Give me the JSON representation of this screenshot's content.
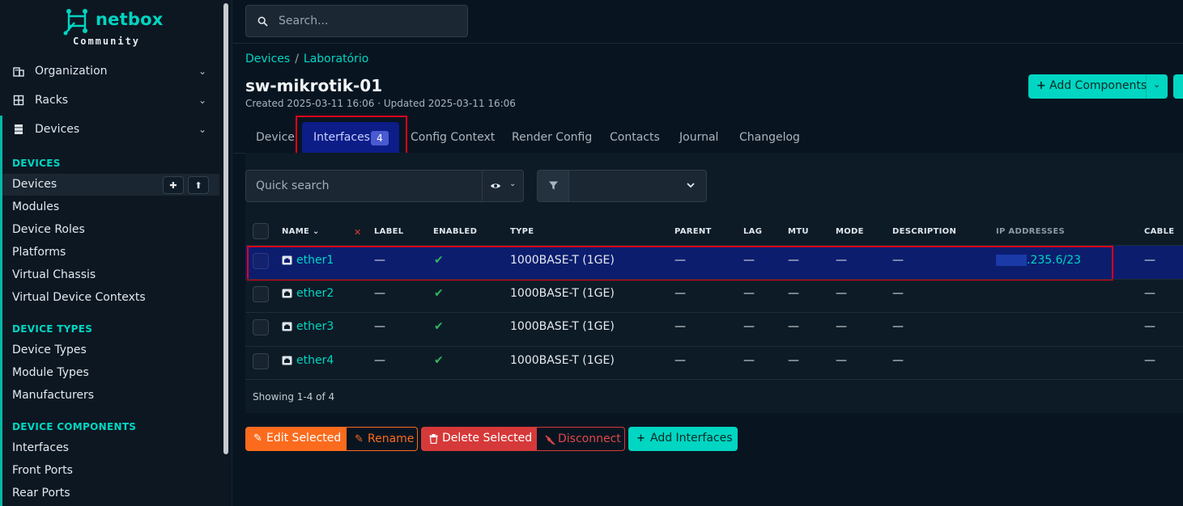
{
  "brand": {
    "name": "netbox",
    "edition": "Community",
    "accent": "#00d6c2"
  },
  "sidebar": {
    "top_menu": [
      {
        "label": "Organization",
        "icon": "organization-icon"
      },
      {
        "label": "Racks",
        "icon": "rack-icon"
      },
      {
        "label": "Devices",
        "icon": "server-icon"
      }
    ],
    "sections": [
      {
        "heading": "DEVICES",
        "items": [
          "Devices",
          "Modules",
          "Device Roles",
          "Platforms",
          "Virtual Chassis",
          "Virtual Device Contexts"
        ]
      },
      {
        "heading": "DEVICE TYPES",
        "items": [
          "Device Types",
          "Module Types",
          "Manufacturers"
        ]
      },
      {
        "heading": "DEVICE COMPONENTS",
        "items": [
          "Interfaces",
          "Front Ports",
          "Rear Ports"
        ]
      }
    ],
    "active_item": "Devices"
  },
  "search": {
    "placeholder": "Search..."
  },
  "breadcrumb": {
    "root": "Devices",
    "site": "Laboratório"
  },
  "device": {
    "name": "sw-mikrotik-01",
    "meta": "Created 2025-03-11 16:06 · Updated 2025-03-11 16:06"
  },
  "actions": {
    "add_components": "Add Components"
  },
  "tabs": [
    {
      "label": "Device"
    },
    {
      "label": "Interfaces",
      "badge": "4",
      "active": true
    },
    {
      "label": "Config Context"
    },
    {
      "label": "Render Config"
    },
    {
      "label": "Contacts"
    },
    {
      "label": "Journal"
    },
    {
      "label": "Changelog"
    }
  ],
  "toolbar": {
    "quick_search_placeholder": "Quick search"
  },
  "table": {
    "columns": [
      "NAME",
      "LABEL",
      "ENABLED",
      "TYPE",
      "PARENT",
      "LAG",
      "MTU",
      "MODE",
      "DESCRIPTION",
      "IP ADDRESSES",
      "CABLE"
    ],
    "rows": [
      {
        "name": "ether1",
        "label": "—",
        "enabled": "✔",
        "type": "1000BASE-T (1GE)",
        "parent": "—",
        "lag": "—",
        "mtu": "—",
        "mode": "—",
        "description": "—",
        "ip": ".235.6/23",
        "cable": "—"
      },
      {
        "name": "ether2",
        "label": "—",
        "enabled": "✔",
        "type": "1000BASE-T (1GE)",
        "parent": "—",
        "lag": "—",
        "mtu": "—",
        "mode": "—",
        "description": "—",
        "ip": "",
        "cable": "—"
      },
      {
        "name": "ether3",
        "label": "—",
        "enabled": "✔",
        "type": "1000BASE-T (1GE)",
        "parent": "—",
        "lag": "—",
        "mtu": "—",
        "mode": "—",
        "description": "—",
        "ip": "",
        "cable": "—"
      },
      {
        "name": "ether4",
        "label": "—",
        "enabled": "✔",
        "type": "1000BASE-T (1GE)",
        "parent": "—",
        "lag": "—",
        "mtu": "—",
        "mode": "—",
        "description": "—",
        "ip": "",
        "cable": "—"
      }
    ],
    "footer": "Showing 1-4 of 4"
  },
  "bulk": {
    "edit_selected": "Edit Selected",
    "rename": "Rename",
    "delete_selected": "Delete Selected",
    "disconnect": "Disconnect",
    "add_interfaces": "Add Interfaces"
  },
  "colors": {
    "danger": "#d63939",
    "warning": "#fb6b1d",
    "success": "#2fb65e",
    "selected_row": "#0c1d6e",
    "highlight": "#e0001a"
  }
}
